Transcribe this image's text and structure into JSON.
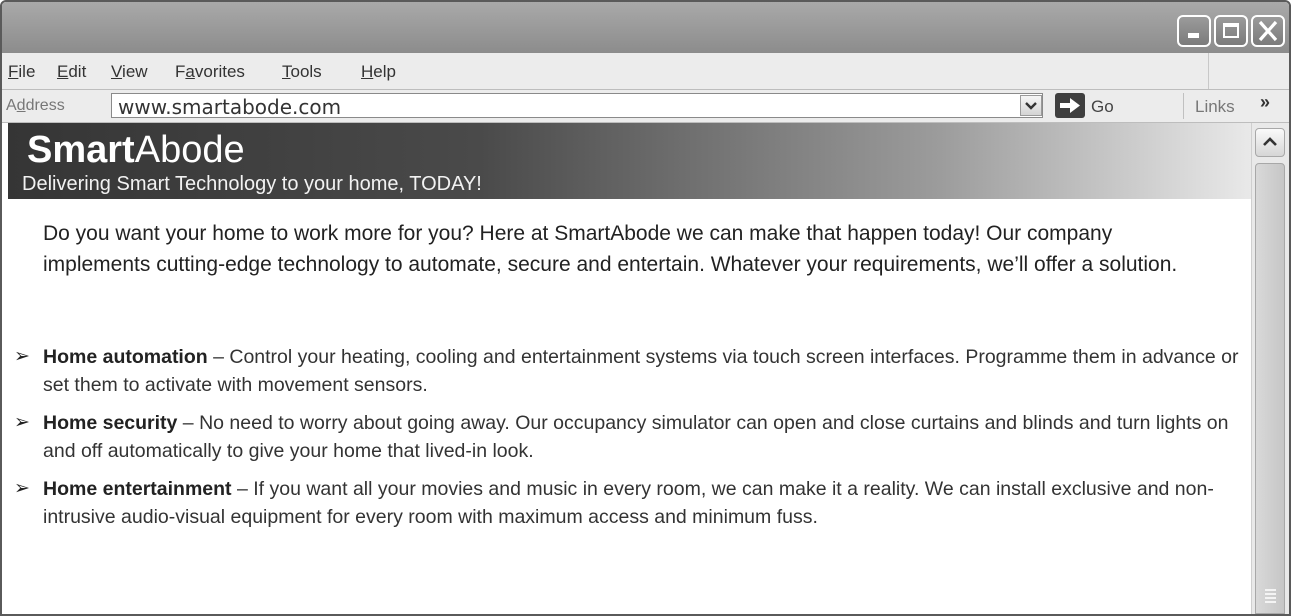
{
  "browser": {
    "menu": [
      {
        "prefix": "",
        "accel": "F",
        "rest": "ile"
      },
      {
        "prefix": "",
        "accel": "E",
        "rest": "dit"
      },
      {
        "prefix": "",
        "accel": "V",
        "rest": "iew"
      },
      {
        "prefix": "F",
        "accel": "a",
        "rest": "vorites"
      },
      {
        "prefix": "",
        "accel": "T",
        "rest": "ools"
      },
      {
        "prefix": "",
        "accel": "H",
        "rest": "elp"
      }
    ],
    "address_label_prefix": "A",
    "address_label_accel": "d",
    "address_label_rest": "dress",
    "address_value": "www.smartabode.com",
    "go_label": "Go",
    "links_label": "Links",
    "links_chevron": "»"
  },
  "page": {
    "brand_bold": "Smart",
    "brand_rest": "Abode",
    "tagline": "Delivering Smart Technology to your home, TODAY!",
    "intro": "Do you want your home to work more for you? Here at SmartAbode we can make that happen today! Our company implements cutting-edge technology to automate, secure and entertain. Whatever your requirements, we’ll offer a solution.",
    "features": [
      {
        "bullet": "➢",
        "title": "Home automation",
        "text": " – Control your heating, cooling and entertainment systems via touch screen interfaces. Programme them in advance or set them to activate with movement sensors."
      },
      {
        "bullet": "➢",
        "title": "Home security",
        "text": " – No need to worry about going away. Our occupancy simulator can open and close curtains and blinds and turn lights on and off automatically to give your home that lived-in look."
      },
      {
        "bullet": "➢",
        "title": "Home entertainment",
        "text": " – If you want all your movies and music in every room, we can make it a reality. We can install exclusive and non-intrusive audio-visual equipment for every room with maximum access and minimum fuss."
      }
    ]
  },
  "icons": {
    "minimize": "minimize-icon",
    "maximize": "maximize-icon",
    "close": "close-icon",
    "dropdown": "chevron-down-icon",
    "go": "arrow-right-icon",
    "scroll_up": "chevron-up-icon"
  },
  "colors": {
    "titlebar": "#9a9a9a",
    "toolbar": "#ececec",
    "banner_dark": "#353535",
    "banner_light": "#e9e9e9"
  }
}
